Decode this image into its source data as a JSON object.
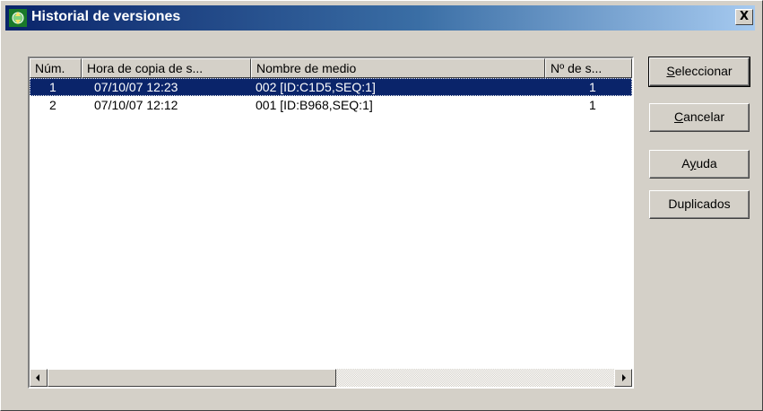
{
  "window": {
    "title": "Historial de versiones",
    "close_label": "X"
  },
  "list": {
    "columns": [
      "Núm.",
      "Hora de copia de s...",
      "Nombre de medio",
      "Nº de s..."
    ],
    "rows": [
      {
        "num": "1",
        "time": "07/10/07 12:23",
        "media": "002 [ID:C1D5,SEQ:1]",
        "seq": "1",
        "selected": true
      },
      {
        "num": "2",
        "time": "07/10/07 12:12",
        "media": "001 [ID:B968,SEQ:1]",
        "seq": "1",
        "selected": false
      }
    ]
  },
  "buttons": {
    "select": {
      "pre": "",
      "key": "S",
      "post": "eleccionar"
    },
    "cancel": {
      "pre": "",
      "key": "C",
      "post": "ancelar"
    },
    "help": {
      "pre": "A",
      "key": "y",
      "post": "uda"
    },
    "duplicates": {
      "pre": "Duplicados",
      "key": "",
      "post": ""
    }
  },
  "colors": {
    "titlebar": "#0a246a",
    "selection": "#0a246a",
    "face": "#d4d0c8"
  },
  "icons": {
    "app": "app-icon",
    "close": "close-icon",
    "scroll_left": "arrow-left-icon",
    "scroll_right": "arrow-right-icon"
  }
}
